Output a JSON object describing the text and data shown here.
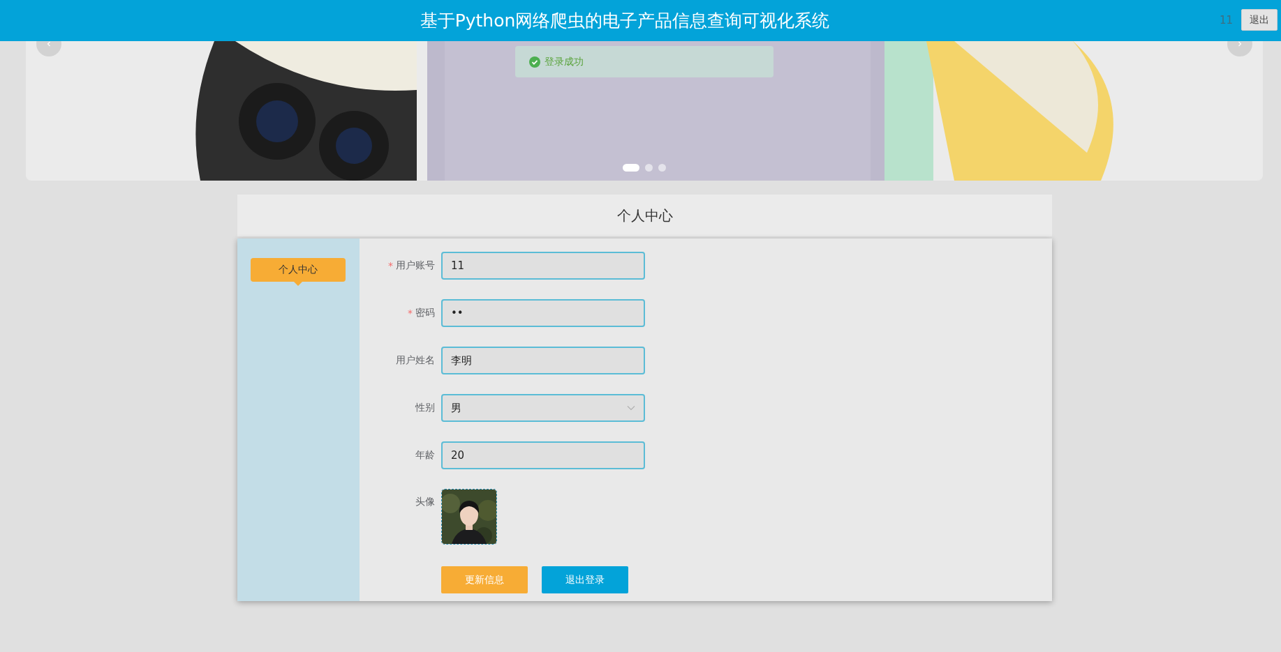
{
  "header": {
    "title": "基于Python网络爬虫的电子产品信息查询可视化系统",
    "username": "11",
    "logout_button": "退出"
  },
  "toast": {
    "text": "登录成功"
  },
  "carousel": {
    "kind": "picture",
    "slides": [
      {
        "selected": true
      },
      {
        "selected": false
      },
      {
        "selected": false
      }
    ]
  },
  "page_title": "个人中心",
  "sidebar": {
    "items": [
      {
        "label": "个人中心",
        "selected": true
      }
    ]
  },
  "form": {
    "fields": [
      {
        "kind": "text",
        "label": "用户账号",
        "required_mark": "*",
        "value": "11"
      },
      {
        "kind": "password",
        "label": "密码",
        "required_mark": "*",
        "value": "••"
      },
      {
        "kind": "text",
        "label": "用户姓名",
        "value": "李明"
      },
      {
        "kind": "select",
        "label": "性别",
        "value": "男"
      },
      {
        "kind": "text",
        "label": "年龄",
        "value": "20"
      },
      {
        "label": "头像"
      }
    ],
    "buttons": [
      {
        "label": "更新信息",
        "kind": "primary"
      },
      {
        "label": "退出登录",
        "kind": "secondary"
      }
    ]
  }
}
